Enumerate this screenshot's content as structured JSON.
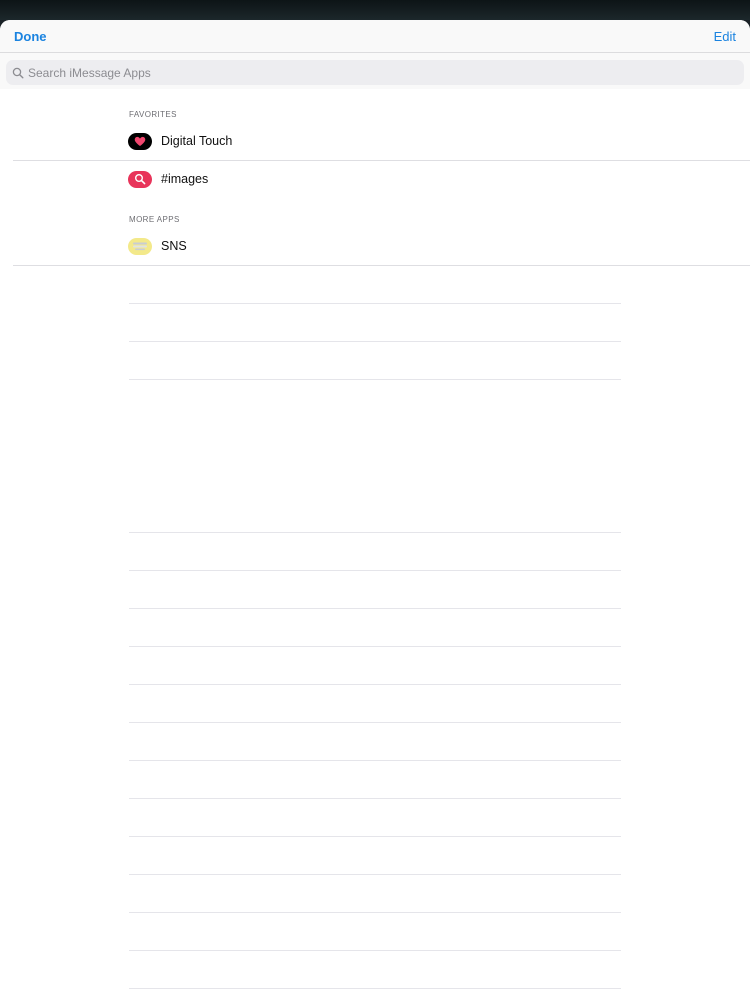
{
  "navbar": {
    "done_label": "Done",
    "edit_label": "Edit"
  },
  "search": {
    "placeholder": "Search iMessage Apps",
    "icon": "search-icon"
  },
  "sections": {
    "favorites": {
      "title": "FAVORITES",
      "items": [
        {
          "label": "Digital Touch",
          "icon": "digital-touch-icon",
          "color": "#000000"
        },
        {
          "label": "#images",
          "icon": "images-search-icon",
          "color": "#e8345a"
        }
      ]
    },
    "more_apps": {
      "title": "MORE APPS",
      "items": [
        {
          "label": "SNS",
          "icon": "sns-icon",
          "color": "#f3e98a"
        }
      ]
    }
  },
  "colors": {
    "accent": "#1a83e0",
    "separator": "#dedee2",
    "background": "#ffffff"
  }
}
